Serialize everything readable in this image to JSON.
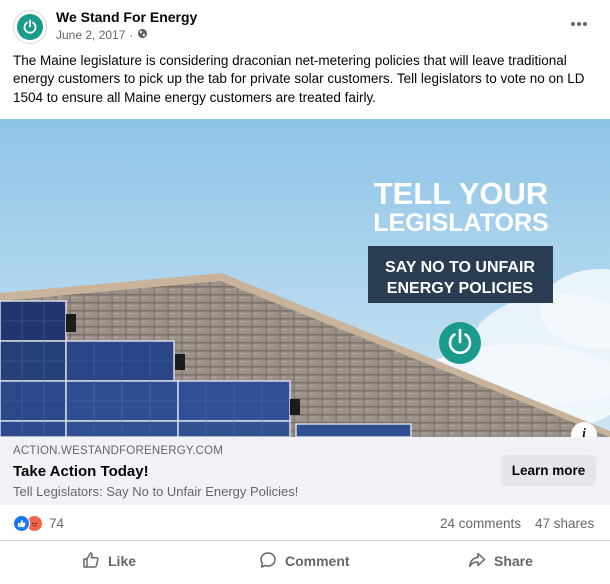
{
  "post": {
    "page_name": "We Stand For Energy",
    "date": "June 2, 2017",
    "privacy_icon": "globe-icon",
    "body_text": "The Maine legislature is considering draconian net-metering policies that will leave traditional energy customers to pick up the tab for private solar customers. Tell legislators to vote no on LD 1504 to ensure all Maine energy customers are treated fairly."
  },
  "ad": {
    "headline_line1": "TELL YOUR",
    "headline_line2": "LEGISLATORS",
    "banner_line1": "SAY NO TO UNFAIR",
    "banner_line2": "ENERGY POLICIES",
    "info_label": "i",
    "domain": "ACTION.WESTANDFORENERGY.COM",
    "title": "Take Action Today!",
    "description": "Tell Legislators: Say No to Unfair Energy Policies!",
    "button_label": "Learn more"
  },
  "stats": {
    "reaction_count": "74",
    "comments": "24 comments",
    "shares": "47 shares"
  },
  "actions": {
    "like": "Like",
    "comment": "Comment",
    "share": "Share"
  },
  "colors": {
    "brand_teal": "#1a9b8c",
    "navy_banner": "#2b3d52",
    "like_blue": "#1877f2"
  }
}
